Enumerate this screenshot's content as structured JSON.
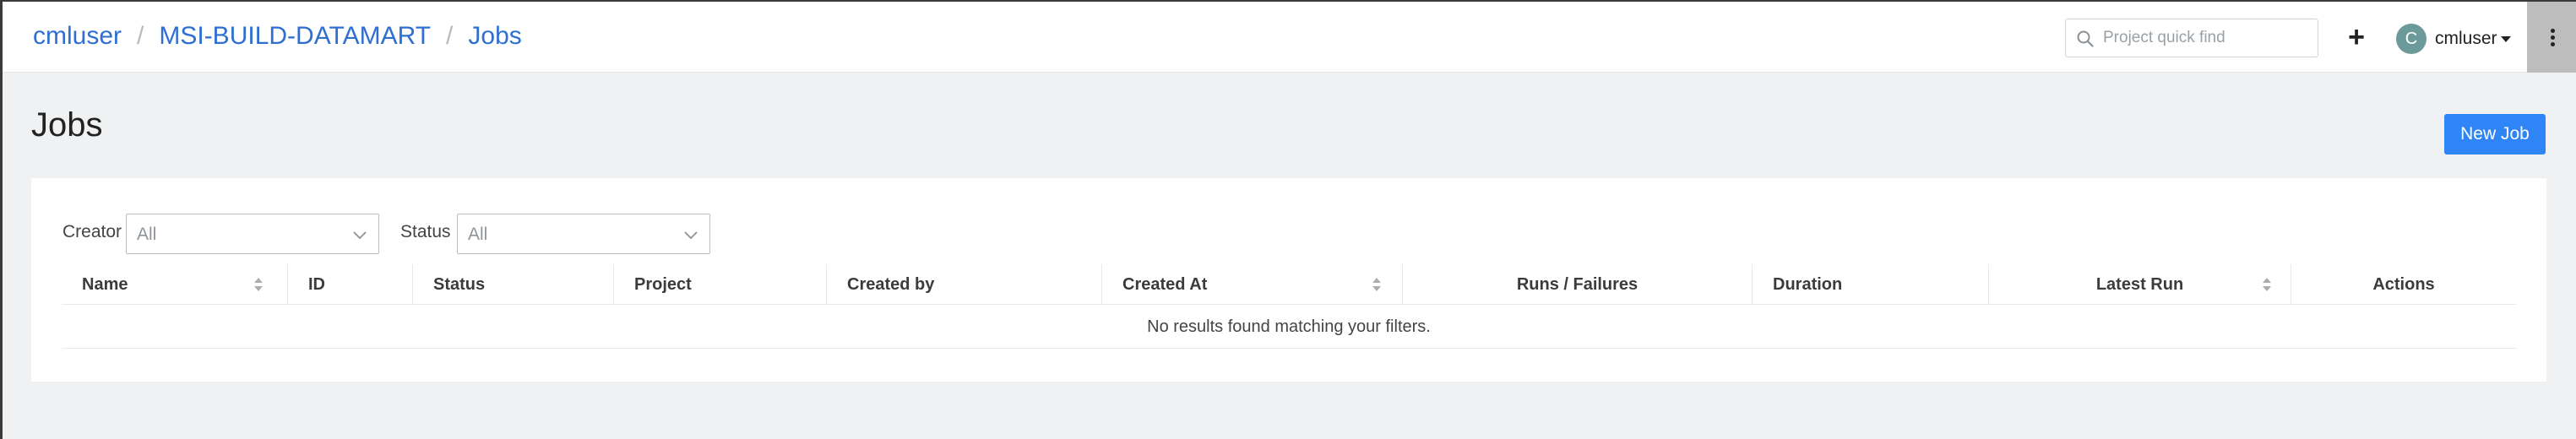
{
  "breadcrumb": {
    "user": "cmluser",
    "project": "MSI-BUILD-DATAMART",
    "current": "Jobs",
    "separator": "/"
  },
  "header": {
    "search_placeholder": "Project quick find",
    "add_symbol": "+",
    "avatar_initial": "C",
    "user_name": "cmluser"
  },
  "page": {
    "title": "Jobs",
    "new_job_label": "New Job"
  },
  "filters": {
    "creator_label": "Creator",
    "creator_value": "All",
    "status_label": "Status",
    "status_value": "All"
  },
  "table": {
    "columns": [
      "Name",
      "ID",
      "Status",
      "Project",
      "Created by",
      "Created At",
      "Runs / Failures",
      "Duration",
      "Latest Run",
      "Actions"
    ],
    "empty_message": "No results found matching your filters."
  },
  "colors": {
    "link": "#2e6fd1",
    "primary_button": "#2f85f5",
    "avatar": "#6c9a9a",
    "page_background": "#f0f1f2"
  }
}
